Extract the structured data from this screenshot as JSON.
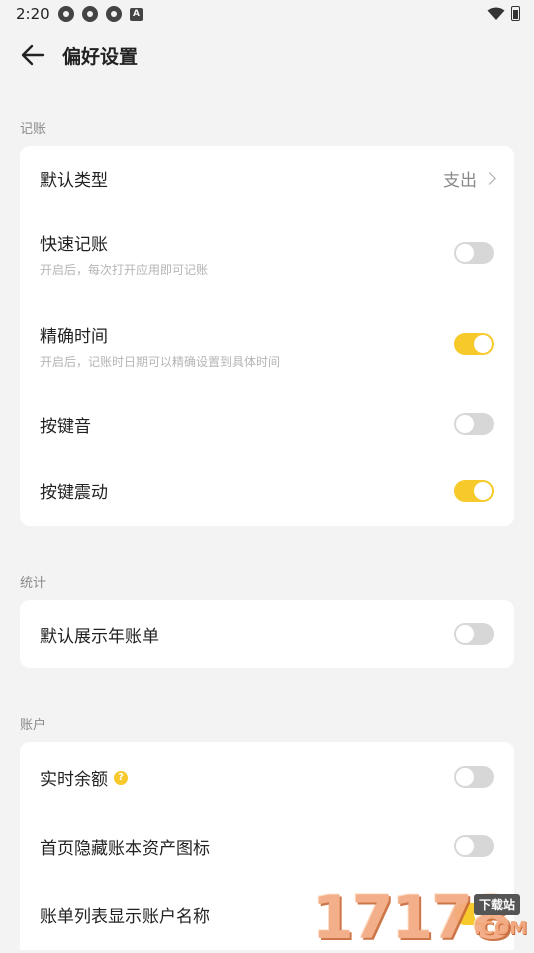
{
  "status_bar": {
    "time": "2:20",
    "left_icons": [
      "notification-icon",
      "notification-icon",
      "notification-icon",
      "app-a-icon"
    ],
    "right_icons": [
      "wifi-icon",
      "battery-icon"
    ],
    "a_icon_text": "A"
  },
  "header": {
    "title": "偏好设置",
    "back_icon": "arrow-left-icon"
  },
  "sections": {
    "bookkeeping": {
      "title": "记账",
      "default_type": {
        "label": "默认类型",
        "value": "支出"
      },
      "quick_bookkeeping": {
        "label": "快速记账",
        "sub": "开启后，每次打开应用即可记账",
        "enabled": false
      },
      "precise_time": {
        "label": "精确时间",
        "sub": "开启后，记账时日期可以精确设置到具体时间",
        "enabled": true
      },
      "key_sound": {
        "label": "按键音",
        "enabled": false
      },
      "key_vibration": {
        "label": "按键震动",
        "enabled": true
      }
    },
    "statistics": {
      "title": "统计",
      "show_year_bill": {
        "label": "默认展示年账单",
        "enabled": false
      }
    },
    "account": {
      "title": "账户",
      "realtime_balance": {
        "label": "实时余额",
        "help_icon": "question-icon",
        "help_text": "?",
        "enabled": false
      },
      "hide_book_asset_icon": {
        "label": "首页隐藏账本资产图标",
        "enabled": false
      },
      "show_account_name": {
        "label": "账单列表显示账户名称",
        "enabled": true
      }
    }
  },
  "watermark": {
    "digits": "17178",
    "tag": "下载站",
    "suffix": ".COM"
  },
  "colors": {
    "accent": "#f7c92b",
    "background": "#f3f3f3",
    "card": "#ffffff",
    "toggle_off": "#d7d7d7"
  }
}
